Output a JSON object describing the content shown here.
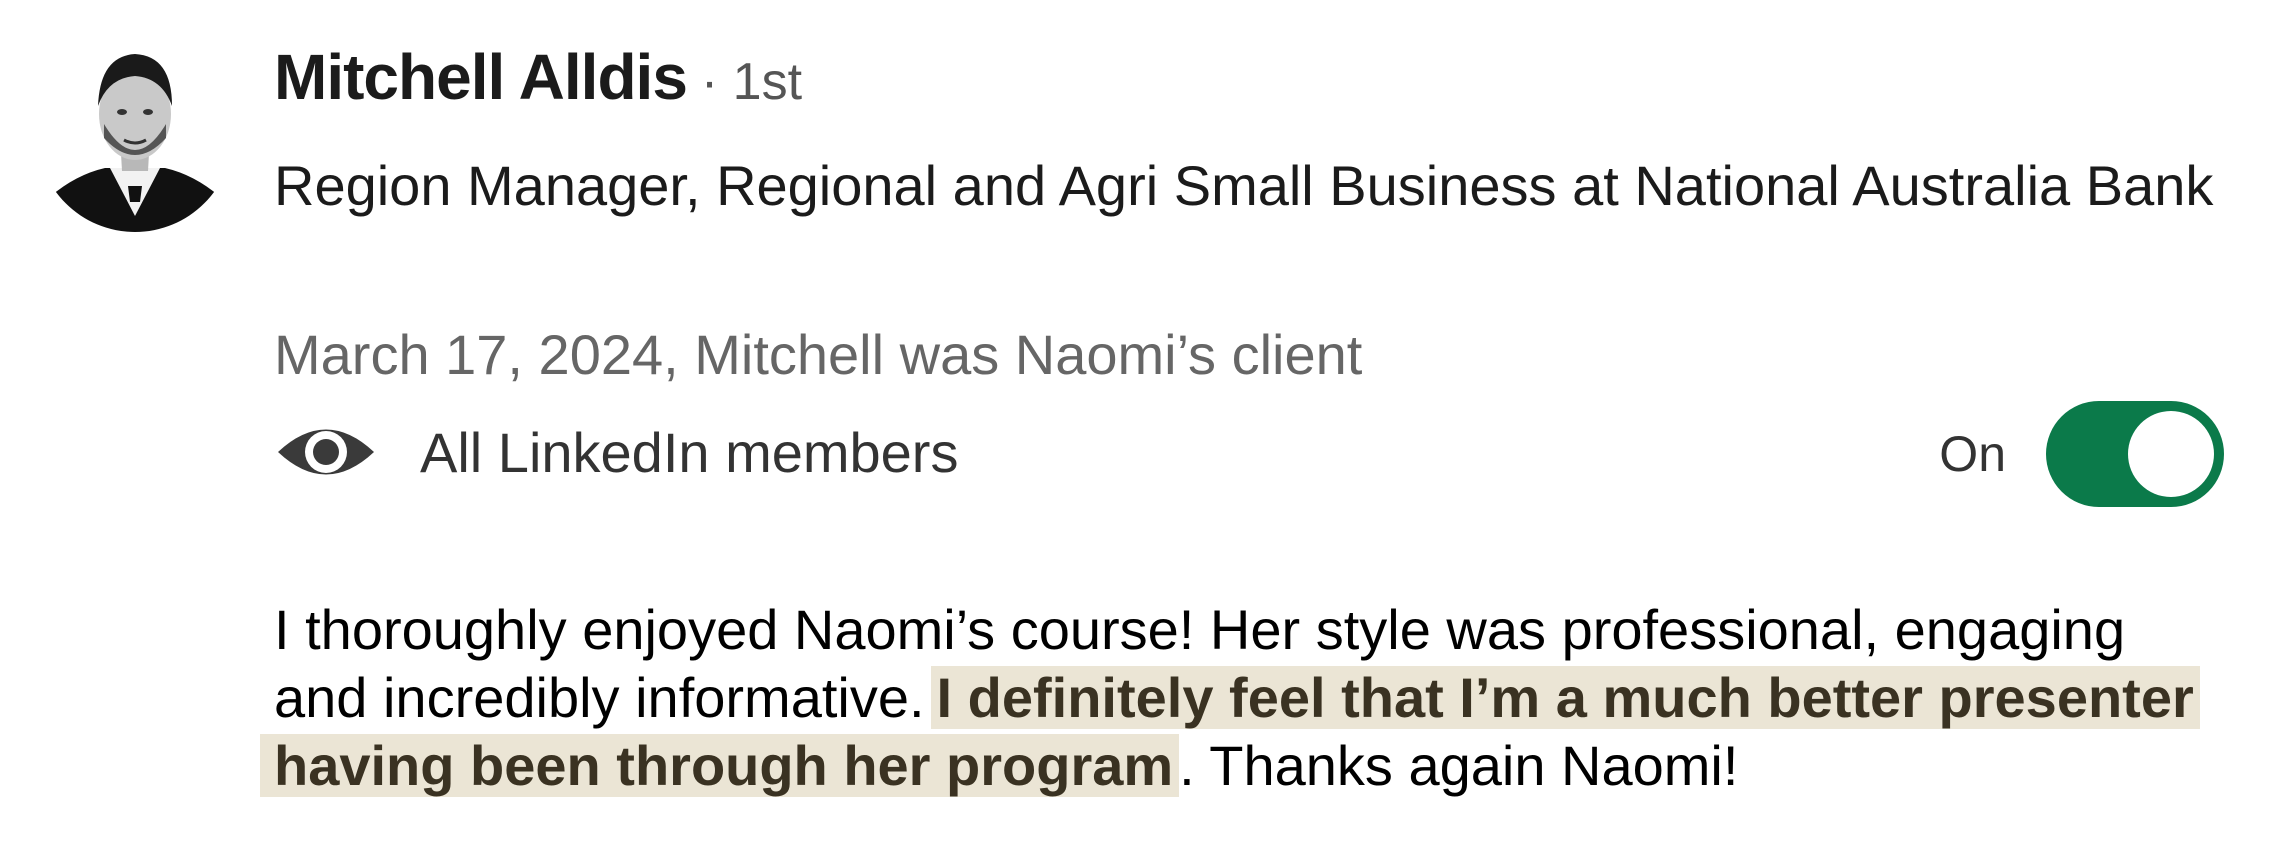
{
  "profile": {
    "name": "Mitchell Alldis",
    "degree": "· 1st",
    "headline": "Region Manager, Regional and Agri Small Business at National Australia Bank",
    "meta": "March 17, 2024, Mitchell was Naomi’s client"
  },
  "visibility": {
    "icon": "eye-icon",
    "label": "All LinkedIn members",
    "toggle_label": "On",
    "toggle_on": true,
    "toggle_color": "#0b7a4a"
  },
  "recommendation": {
    "line1": "I thoroughly enjoyed Naomi’s course! Her style was professional, engaging",
    "line2_plain": "and incredibly informative.",
    "line2_highlight": "I definitely feel that I’m a much better presenter",
    "line3_highlight": "having been through her program",
    "line3_plain": ". Thanks again Naomi!",
    "highlight_color": "#ebe5d5"
  }
}
